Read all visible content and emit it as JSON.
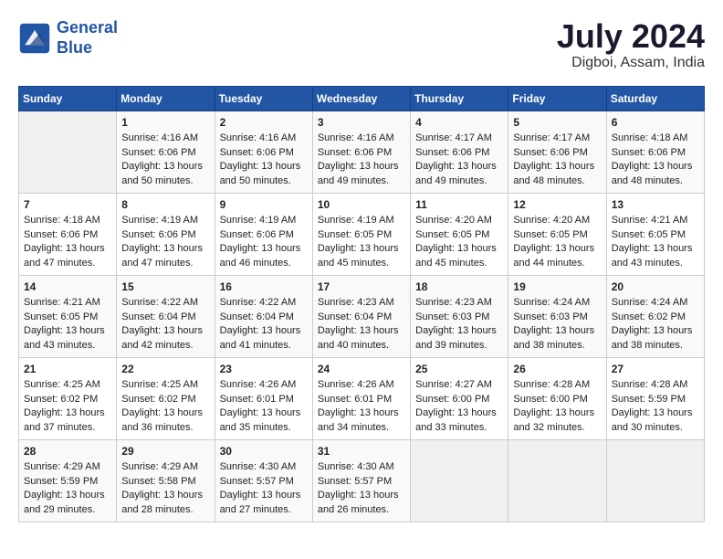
{
  "header": {
    "logo_line1": "General",
    "logo_line2": "Blue",
    "month": "July 2024",
    "location": "Digboi, Assam, India"
  },
  "weekdays": [
    "Sunday",
    "Monday",
    "Tuesday",
    "Wednesday",
    "Thursday",
    "Friday",
    "Saturday"
  ],
  "weeks": [
    [
      {
        "day": "",
        "empty": true
      },
      {
        "day": "1",
        "sunrise": "4:16 AM",
        "sunset": "6:06 PM",
        "daylight": "13 hours and 50 minutes."
      },
      {
        "day": "2",
        "sunrise": "4:16 AM",
        "sunset": "6:06 PM",
        "daylight": "13 hours and 50 minutes."
      },
      {
        "day": "3",
        "sunrise": "4:16 AM",
        "sunset": "6:06 PM",
        "daylight": "13 hours and 49 minutes."
      },
      {
        "day": "4",
        "sunrise": "4:17 AM",
        "sunset": "6:06 PM",
        "daylight": "13 hours and 49 minutes."
      },
      {
        "day": "5",
        "sunrise": "4:17 AM",
        "sunset": "6:06 PM",
        "daylight": "13 hours and 48 minutes."
      },
      {
        "day": "6",
        "sunrise": "4:18 AM",
        "sunset": "6:06 PM",
        "daylight": "13 hours and 48 minutes."
      }
    ],
    [
      {
        "day": "7",
        "sunrise": "4:18 AM",
        "sunset": "6:06 PM",
        "daylight": "13 hours and 47 minutes."
      },
      {
        "day": "8",
        "sunrise": "4:19 AM",
        "sunset": "6:06 PM",
        "daylight": "13 hours and 47 minutes."
      },
      {
        "day": "9",
        "sunrise": "4:19 AM",
        "sunset": "6:06 PM",
        "daylight": "13 hours and 46 minutes."
      },
      {
        "day": "10",
        "sunrise": "4:19 AM",
        "sunset": "6:05 PM",
        "daylight": "13 hours and 45 minutes."
      },
      {
        "day": "11",
        "sunrise": "4:20 AM",
        "sunset": "6:05 PM",
        "daylight": "13 hours and 45 minutes."
      },
      {
        "day": "12",
        "sunrise": "4:20 AM",
        "sunset": "6:05 PM",
        "daylight": "13 hours and 44 minutes."
      },
      {
        "day": "13",
        "sunrise": "4:21 AM",
        "sunset": "6:05 PM",
        "daylight": "13 hours and 43 minutes."
      }
    ],
    [
      {
        "day": "14",
        "sunrise": "4:21 AM",
        "sunset": "6:05 PM",
        "daylight": "13 hours and 43 minutes."
      },
      {
        "day": "15",
        "sunrise": "4:22 AM",
        "sunset": "6:04 PM",
        "daylight": "13 hours and 42 minutes."
      },
      {
        "day": "16",
        "sunrise": "4:22 AM",
        "sunset": "6:04 PM",
        "daylight": "13 hours and 41 minutes."
      },
      {
        "day": "17",
        "sunrise": "4:23 AM",
        "sunset": "6:04 PM",
        "daylight": "13 hours and 40 minutes."
      },
      {
        "day": "18",
        "sunrise": "4:23 AM",
        "sunset": "6:03 PM",
        "daylight": "13 hours and 39 minutes."
      },
      {
        "day": "19",
        "sunrise": "4:24 AM",
        "sunset": "6:03 PM",
        "daylight": "13 hours and 38 minutes."
      },
      {
        "day": "20",
        "sunrise": "4:24 AM",
        "sunset": "6:02 PM",
        "daylight": "13 hours and 38 minutes."
      }
    ],
    [
      {
        "day": "21",
        "sunrise": "4:25 AM",
        "sunset": "6:02 PM",
        "daylight": "13 hours and 37 minutes."
      },
      {
        "day": "22",
        "sunrise": "4:25 AM",
        "sunset": "6:02 PM",
        "daylight": "13 hours and 36 minutes."
      },
      {
        "day": "23",
        "sunrise": "4:26 AM",
        "sunset": "6:01 PM",
        "daylight": "13 hours and 35 minutes."
      },
      {
        "day": "24",
        "sunrise": "4:26 AM",
        "sunset": "6:01 PM",
        "daylight": "13 hours and 34 minutes."
      },
      {
        "day": "25",
        "sunrise": "4:27 AM",
        "sunset": "6:00 PM",
        "daylight": "13 hours and 33 minutes."
      },
      {
        "day": "26",
        "sunrise": "4:28 AM",
        "sunset": "6:00 PM",
        "daylight": "13 hours and 32 minutes."
      },
      {
        "day": "27",
        "sunrise": "4:28 AM",
        "sunset": "5:59 PM",
        "daylight": "13 hours and 30 minutes."
      }
    ],
    [
      {
        "day": "28",
        "sunrise": "4:29 AM",
        "sunset": "5:59 PM",
        "daylight": "13 hours and 29 minutes."
      },
      {
        "day": "29",
        "sunrise": "4:29 AM",
        "sunset": "5:58 PM",
        "daylight": "13 hours and 28 minutes."
      },
      {
        "day": "30",
        "sunrise": "4:30 AM",
        "sunset": "5:57 PM",
        "daylight": "13 hours and 27 minutes."
      },
      {
        "day": "31",
        "sunrise": "4:30 AM",
        "sunset": "5:57 PM",
        "daylight": "13 hours and 26 minutes."
      },
      {
        "day": "",
        "empty": true
      },
      {
        "day": "",
        "empty": true
      },
      {
        "day": "",
        "empty": true
      }
    ]
  ]
}
